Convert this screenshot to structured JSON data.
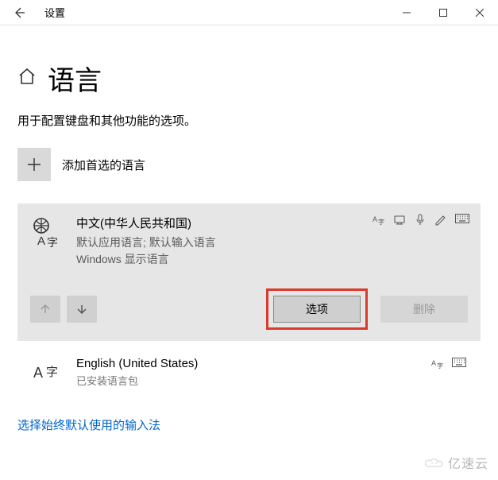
{
  "titlebar": {
    "app_title": "设置"
  },
  "page": {
    "title": "语言",
    "subtitle": "用于配置键盘和其他功能的选项。"
  },
  "add": {
    "label": "添加首选的语言"
  },
  "languages": [
    {
      "name": "中文(中华人民共和国)",
      "detail_line1": "默认应用语言; 默认输入语言",
      "detail_line2": "Windows 显示语言"
    },
    {
      "name": "English (United States)",
      "detail_line1": "已安装语言包",
      "detail_line2": ""
    }
  ],
  "buttons": {
    "options": "选项",
    "delete": "删除"
  },
  "link": {
    "always_default_ime": "选择始终默认使用的输入法"
  },
  "watermark": "亿速云"
}
